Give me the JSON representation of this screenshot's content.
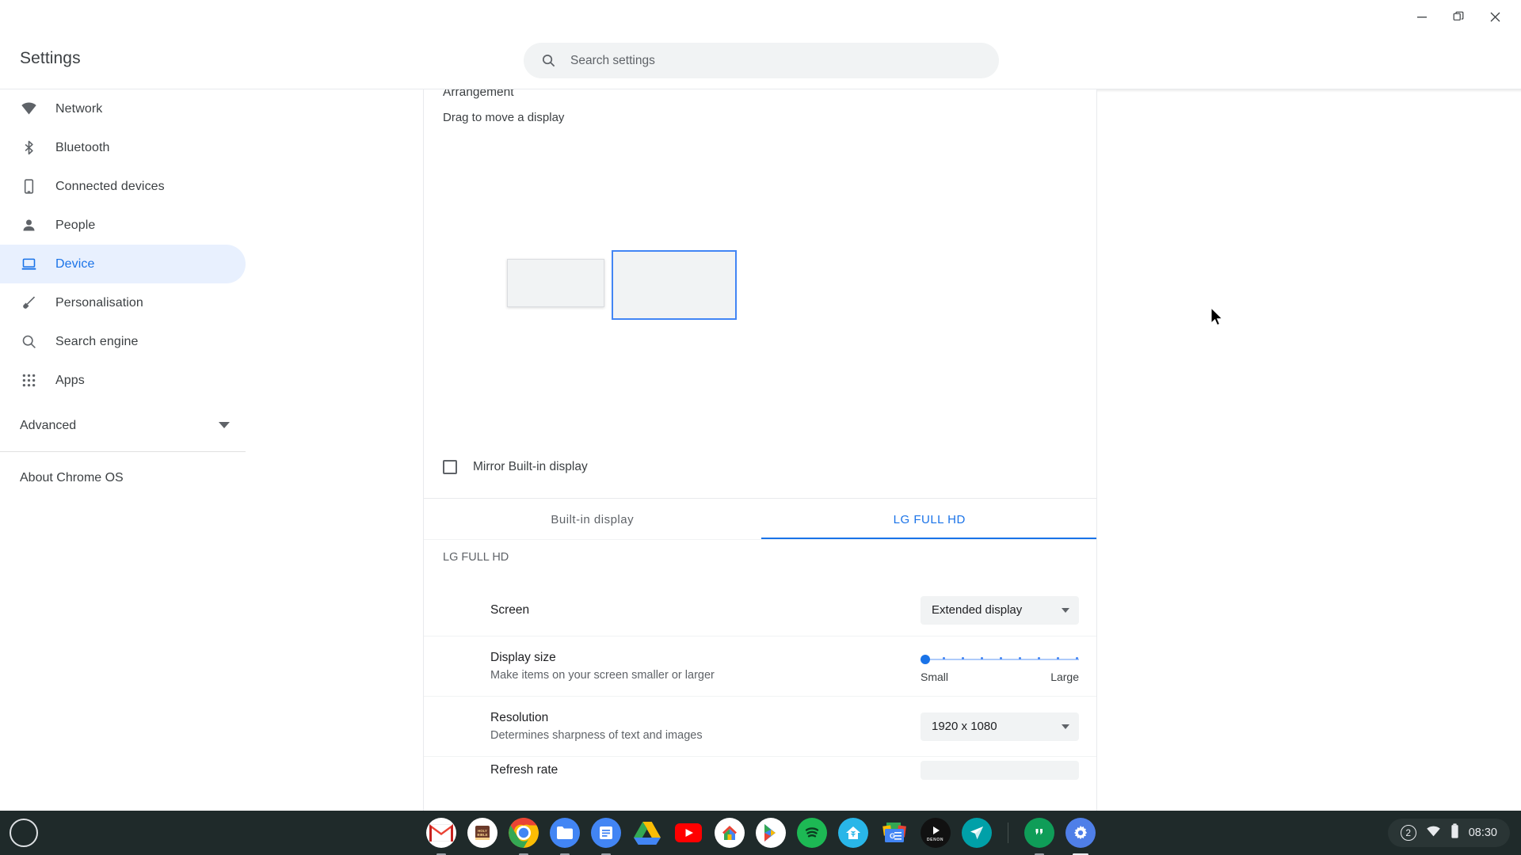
{
  "window": {
    "minimize_icon": "minimize-icon",
    "restore_icon": "restore-window-icon",
    "close_icon": "close-icon"
  },
  "header": {
    "title": "Settings",
    "search_icon": "search-icon",
    "search_placeholder": "Search settings",
    "search_value": ""
  },
  "sidebar": {
    "items": [
      {
        "label": "Network",
        "icon": "wifi-icon",
        "selected": false
      },
      {
        "label": "Bluetooth",
        "icon": "bluetooth-icon",
        "selected": false
      },
      {
        "label": "Connected devices",
        "icon": "phone-icon",
        "selected": false
      },
      {
        "label": "People",
        "icon": "person-icon",
        "selected": false
      },
      {
        "label": "Device",
        "icon": "laptop-icon",
        "selected": true
      },
      {
        "label": "Personalisation",
        "icon": "brush-icon",
        "selected": false
      },
      {
        "label": "Search engine",
        "icon": "search-icon",
        "selected": false
      },
      {
        "label": "Apps",
        "icon": "grid-apps-icon",
        "selected": false
      }
    ],
    "advanced": {
      "label": "Advanced",
      "icon": "chevron-down-icon"
    },
    "about": {
      "label": "About Chrome OS"
    }
  },
  "main": {
    "arrangement_title": "Arrangement",
    "arrangement_sub": "Drag to move a display",
    "displays": [
      {
        "name": "Built-in display",
        "selected": false
      },
      {
        "name": "LG FULL HD",
        "selected": true
      }
    ],
    "mirror": {
      "label": "Mirror Built-in display",
      "checked": false
    },
    "tabs": [
      {
        "label": "Built-in display",
        "active": false
      },
      {
        "label": "LG FULL HD",
        "active": true
      }
    ],
    "section_title": "LG FULL HD",
    "rows": {
      "screen": {
        "label": "Screen",
        "value": "Extended display",
        "caret": "chevron-down-icon"
      },
      "display_size": {
        "label": "Display size",
        "sub": "Make items on your screen smaller or larger",
        "min_label": "Small",
        "max_label": "Large",
        "value_percent": 0,
        "tick_count": 8
      },
      "resolution": {
        "label": "Resolution",
        "sub": "Determines sharpness of text and images",
        "value": "1920 x 1080",
        "caret": "chevron-down-icon"
      },
      "refresh_rate": {
        "label": "Refresh rate"
      }
    }
  },
  "shelf": {
    "launcher_icon": "launcher-circle-icon",
    "apps": [
      {
        "name": "gmail-icon",
        "running": true
      },
      {
        "name": "bible-app-icon",
        "running": false
      },
      {
        "name": "chrome-icon",
        "running": true
      },
      {
        "name": "files-icon",
        "running": true
      },
      {
        "name": "google-keep-icon",
        "running": true
      },
      {
        "name": "google-drive-icon",
        "running": false
      },
      {
        "name": "youtube-icon",
        "running": false
      },
      {
        "name": "google-home-icon",
        "running": false
      },
      {
        "name": "play-store-icon",
        "running": false
      },
      {
        "name": "spotify-icon",
        "running": false
      },
      {
        "name": "smart-home-icon",
        "running": false
      },
      {
        "name": "google-news-icon",
        "running": false
      },
      {
        "name": "denon-icon",
        "running": false
      },
      {
        "name": "teal-paper-plane-icon",
        "running": false
      },
      {
        "name": "hangouts-icon",
        "running": true
      },
      {
        "name": "settings-icon",
        "running": true
      }
    ],
    "tray": {
      "notification_count": "2",
      "wifi_icon": "wifi-icon",
      "battery_icon": "battery-icon",
      "time": "08:30"
    }
  },
  "cursor": {
    "name": "mouse-pointer"
  },
  "colors": {
    "accent": "#1a73e8",
    "selected_bg": "#e8f0fe",
    "shelf_bg": "#1f2a2a",
    "surface": "#f1f3f4"
  }
}
